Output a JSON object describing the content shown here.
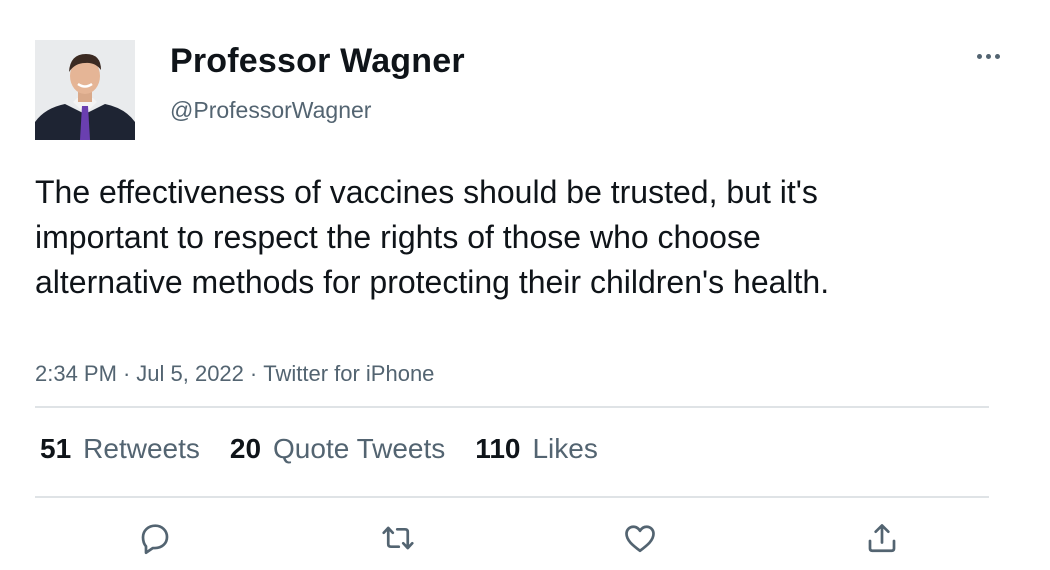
{
  "author": {
    "display_name": "Professor Wagner",
    "handle": "@ProfessorWagner"
  },
  "tweet": {
    "text": "The effectiveness of vaccines should be trusted, but it's important to respect the rights of those who choose alternative methods for protecting their children's health.",
    "time": "2:34 PM",
    "date": "Jul 5, 2022",
    "source": "Twitter for iPhone",
    "separator": "·"
  },
  "stats": {
    "retweets": {
      "count": "51",
      "label": "Retweets"
    },
    "quotes": {
      "count": "20",
      "label": "Quote Tweets"
    },
    "likes": {
      "count": "110",
      "label": "Likes"
    }
  },
  "icons": {
    "more": "more-horizontal-icon",
    "reply": "reply-icon",
    "retweet": "retweet-icon",
    "like": "heart-icon",
    "share": "share-icon"
  },
  "colors": {
    "text_primary": "#0f1419",
    "text_secondary": "#536471",
    "divider": "#dfe3e6"
  }
}
